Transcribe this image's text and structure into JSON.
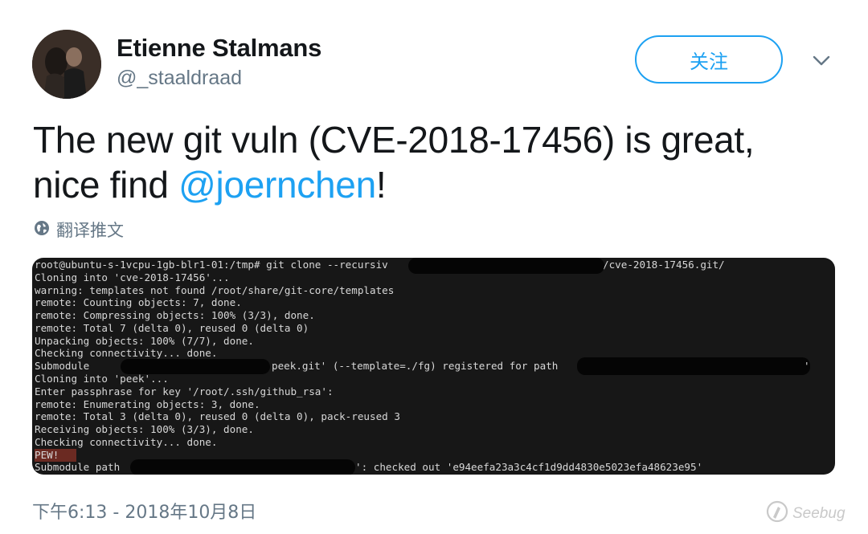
{
  "author": {
    "display_name": "Etienne Stalmans",
    "handle": "@_staaldraad"
  },
  "follow_button": {
    "label": "关注"
  },
  "menu": {
    "icon": "chevron-down-icon"
  },
  "tweet": {
    "text_part1": "The new git vuln (CVE-2018-17456) is great,",
    "text_part2": "nice find ",
    "mention": "@joernchen",
    "text_part3": "!"
  },
  "translate": {
    "icon": "globe-icon",
    "label": "翻译推文"
  },
  "terminal": {
    "lines": [
      "root@ubuntu-s-1vcpu-1gb-blr1-01:/tmp# git clone --recursiv",
      "Cloning into 'cve-2018-17456'...",
      "warning: templates not found /root/share/git-core/templates",
      "remote: Counting objects: 7, done.",
      "remote: Compressing objects: 100% (3/3), done.",
      "remote: Total 7 (delta 0), reused 0 (delta 0)",
      "Unpacking objects: 100% (7/7), done.",
      "Checking connectivity... done.",
      "Submodule",
      "Cloning into 'peek'...",
      "Enter passphrase for key '/root/.ssh/github_rsa':",
      "remote: Enumerating objects: 3, done.",
      "remote: Total 3 (delta 0), reused 0 (delta 0), pack-reused 3",
      "Receiving objects: 100% (3/3), done.",
      "Checking connectivity... done.",
      "PEW!",
      "Submodule path"
    ],
    "line1_suffix": "/cve-2018-17456.git/",
    "line9_suffix": "peek.git' (--template=./fg) registered for path",
    "line9_end": "'",
    "line17_suffix": "': checked out 'e94eefa23a3c4cf1d9dd4830e5023efa48623e95'"
  },
  "timestamp": "下午6:13 - 2018年10月8日",
  "watermark": {
    "icon": "seebug-logo-icon",
    "label": "Seebug"
  },
  "colors": {
    "accent": "#1da1f2",
    "secondary_text": "#657786",
    "terminal_bg": "#171717",
    "pew_highlight": "#6b2a22"
  }
}
